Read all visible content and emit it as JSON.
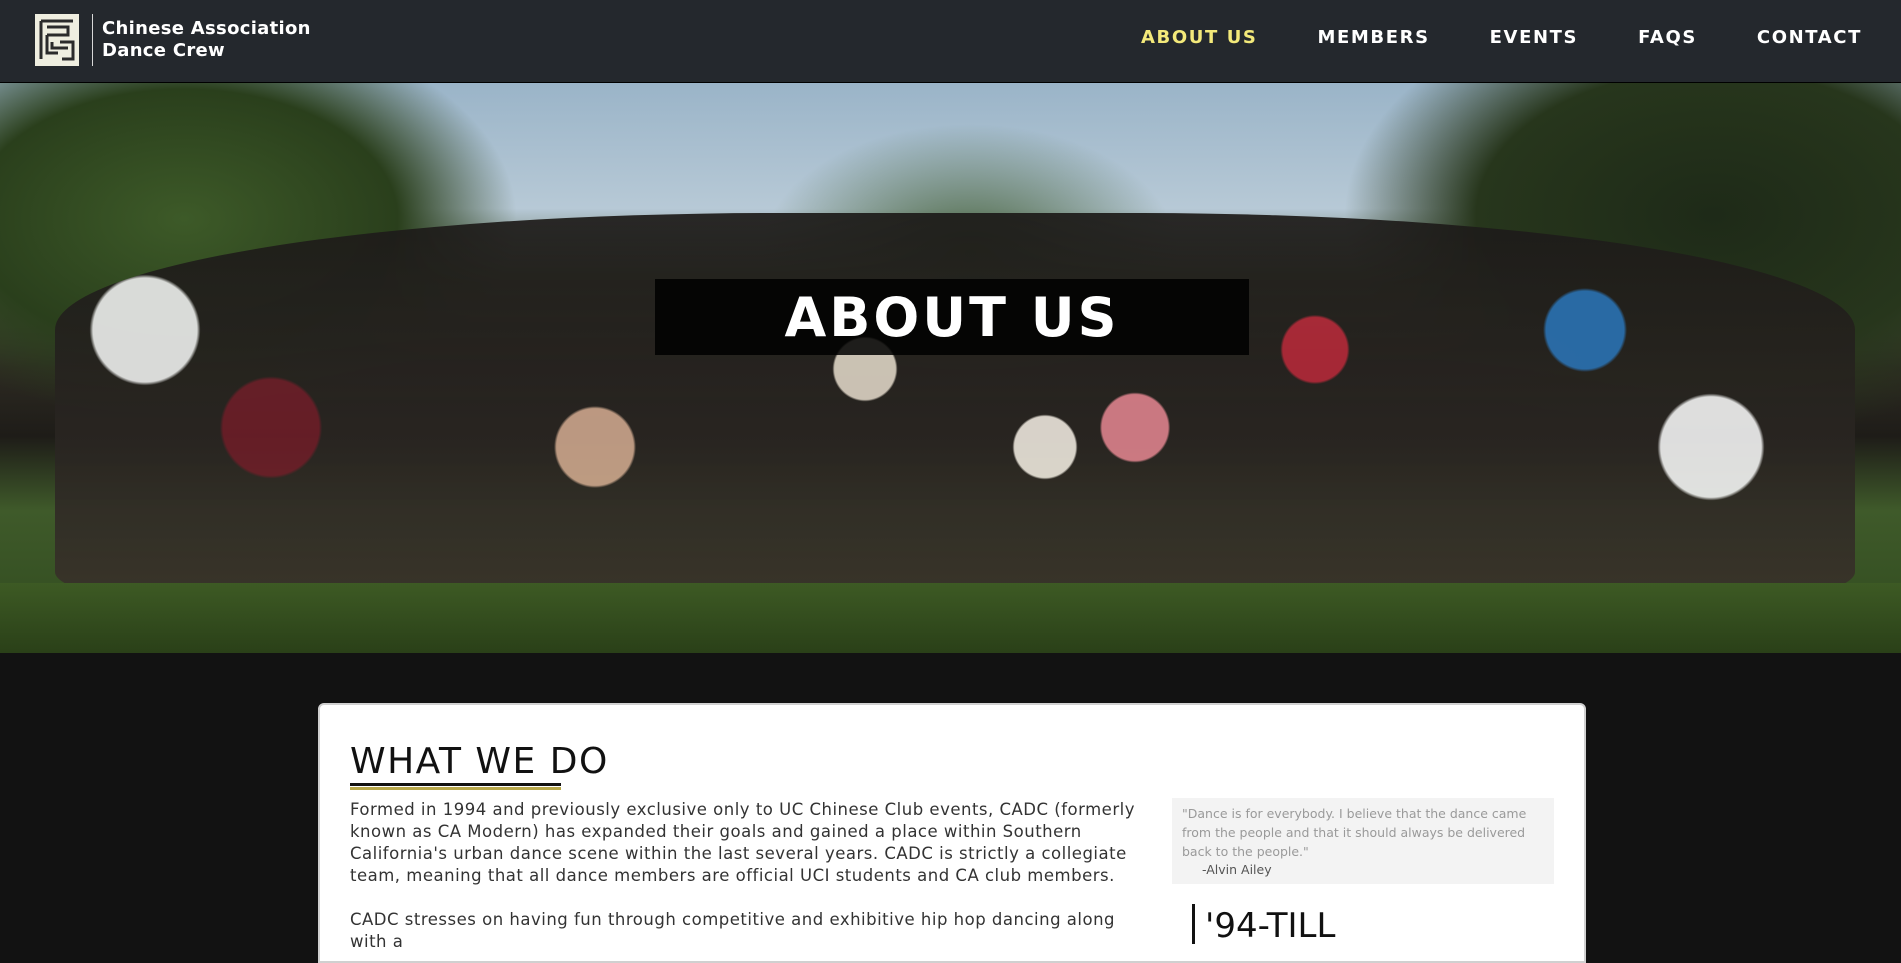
{
  "brand": {
    "logo_icon": "cadc-logo-icon",
    "name_line1": "Chinese Association",
    "name_line2": "Dance Crew"
  },
  "nav": {
    "items": [
      {
        "label": "ABOUT US",
        "active": true
      },
      {
        "label": "MEMBERS",
        "active": false
      },
      {
        "label": "EVENTS",
        "active": false
      },
      {
        "label": "FAQS",
        "active": false
      },
      {
        "label": "CONTACT",
        "active": false
      }
    ]
  },
  "hero": {
    "title": "ABOUT US"
  },
  "main": {
    "section_title": "WHAT WE DO",
    "paragraph1": "Formed in 1994 and previously exclusive only to UC Chinese Club events, CADC (formerly known as CA Modern) has expanded their goals and gained a place within Southern California's urban dance scene within the last several years. CADC is strictly a collegiate team, meaning that all dance members are official UCI students and CA club members.",
    "paragraph2": "CADC stresses on having fun through competitive and exhibitive hip hop dancing along with a",
    "quote_text": "\"Dance is for everybody. I believe that the dance came from the people and that it should always be delivered back to the people.\"",
    "quote_author": "-Alvin Ailey",
    "side_heading": "'94-TILL"
  },
  "colors": {
    "nav_bg": "#24282d",
    "nav_active": "#f3e97a",
    "page_bg": "#121212",
    "accent_gold": "#b8a84a"
  }
}
